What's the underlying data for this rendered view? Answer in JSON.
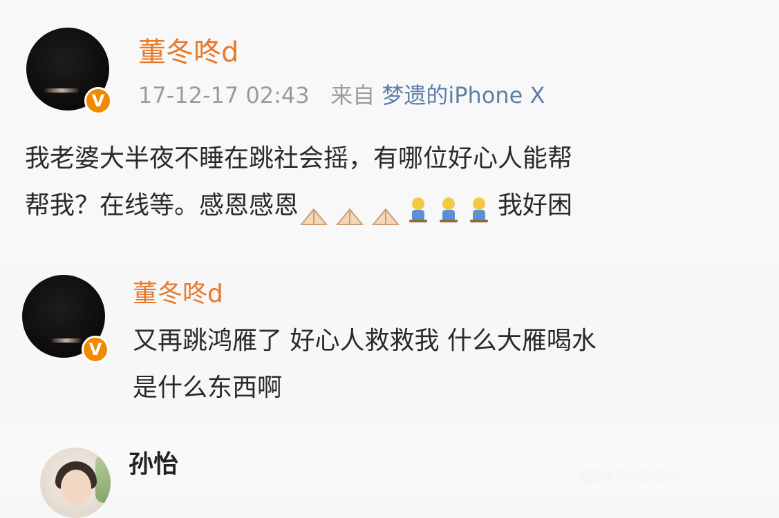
{
  "post": {
    "author": "董冬咚d",
    "timestamp": "17-12-17 02:43",
    "from_prefix": "来自",
    "source": "梦遗的iPhone X",
    "text_line1": "我老婆大半夜不睡在跳社会摇，有哪位好心人能帮",
    "text_line2": "帮我？在线等。感恩感恩",
    "text_tail": "我好困",
    "emoji_pray_count": 3,
    "emoji_sleepy_count": 3,
    "verified_badge": "V"
  },
  "reply": {
    "author": "董冬咚d",
    "text_line1": "又再跳鸿雁了 好心人救救我 什么大雁喝水",
    "text_line2": "是什么东西啊",
    "verified_badge": "V"
  },
  "reply2": {
    "author": "孙怡"
  },
  "watermark": "/ 咖啡杂谈娱乐",
  "colors": {
    "name": "#e7792a",
    "meta": "#9b9b9b",
    "source": "#5b7fa7",
    "badge": "#f08a00"
  },
  "icons": [
    "verified-v-icon",
    "pray-hands-emoji",
    "sleepy-emoji"
  ]
}
